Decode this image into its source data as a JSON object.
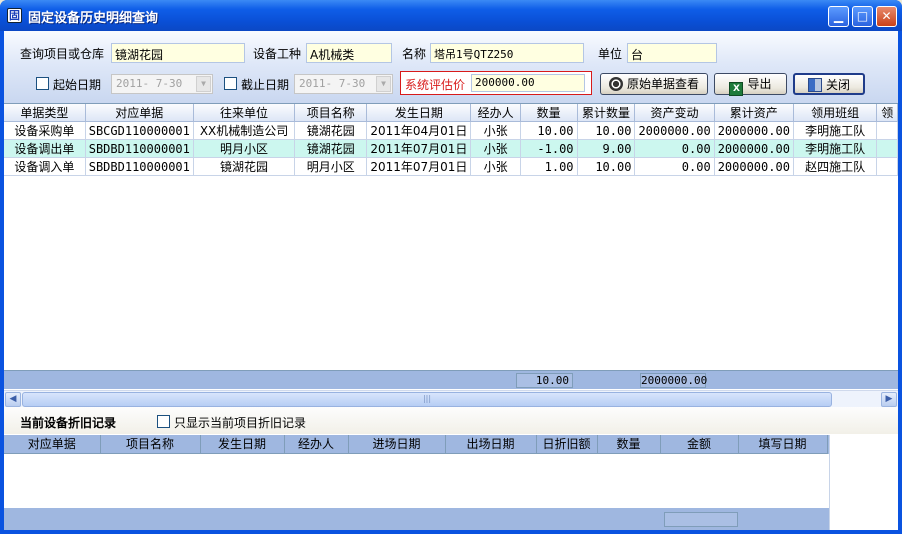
{
  "window": {
    "title": "固定设备历史明细查询",
    "icon_glyph": "固",
    "controls": {
      "minimize": "▁",
      "maximize": "□",
      "close": "✕"
    }
  },
  "query": {
    "project_label": "查询项目或仓库",
    "project_value": "镜湖花园",
    "type_label": "设备工种",
    "type_value": "A机械类",
    "name_label": "名称",
    "name_value": "塔吊1号QTZ250",
    "unit_label": "单位",
    "unit_value": "台",
    "start_date_label": "起始日期",
    "start_date_value": "2011- 7-30",
    "end_date_label": "截止日期",
    "end_date_value": "2011- 7-30",
    "eval_label": "系统评估价",
    "eval_value": "200000.00"
  },
  "buttons": {
    "view_original": "原始单据查看",
    "export": "导出",
    "close": "关闭"
  },
  "main_table": {
    "columns": [
      "单据类型",
      "对应单据",
      "往来单位",
      "项目名称",
      "发生日期",
      "经办人",
      "数量",
      "累计数量",
      "资产变动",
      "累计资产",
      "领用班组",
      "领"
    ],
    "rows": [
      [
        "设备采购单",
        "SBCGD110000001",
        "XX机械制造公司",
        "镜湖花园",
        "2011年04月01日",
        "小张",
        "10.00",
        "10.00",
        "2000000.00",
        "2000000.00",
        "李明施工队",
        ""
      ],
      [
        "设备调出单",
        "SBDBD110000001",
        "明月小区",
        "镜湖花园",
        "2011年07月01日",
        "小张",
        "-1.00",
        "9.00",
        "0.00",
        "2000000.00",
        "李明施工队",
        ""
      ],
      [
        "设备调入单",
        "SBDBD110000001",
        "镜湖花园",
        "明月小区",
        "2011年07月01日",
        "小张",
        "1.00",
        "10.00",
        "0.00",
        "2000000.00",
        "赵四施工队",
        ""
      ]
    ],
    "totals": {
      "quantity": "10.00",
      "asset_change": "2000000.00"
    }
  },
  "depreciation": {
    "title": "当前设备折旧记录",
    "only_current_label": "只显示当前项目折旧记录",
    "columns": [
      "对应单据",
      "项目名称",
      "发生日期",
      "经办人",
      "进场日期",
      "出场日期",
      "日折旧额",
      "数量",
      "金额",
      "填写日期"
    ]
  },
  "colors": {
    "title_bar": "#0a4fd6",
    "alt_row": "#ccf7ef",
    "eval_highlight": "#d81a1a",
    "field_bg": "#ffffe1"
  }
}
